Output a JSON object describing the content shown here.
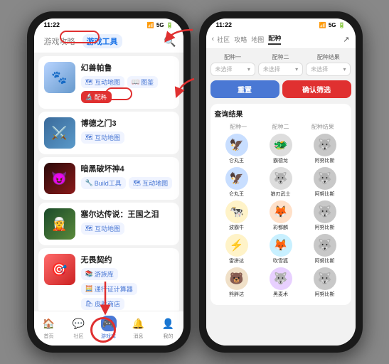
{
  "phone1": {
    "statusBar": {
      "time": "11:22",
      "icons": "📶 5G ◼"
    },
    "header": {
      "tab1": "游戏攻略",
      "tab2": "游戏工具",
      "searchIcon": "🔍"
    },
    "games": [
      {
        "id": "pokemon",
        "name": "幻兽帕鲁",
        "thumb": "🐾",
        "thumbClass": "thumb-pokemon",
        "tools": [
          {
            "label": "互动地图",
            "icon": "🗺",
            "class": "tool-btn"
          },
          {
            "label": "图鉴",
            "icon": "📖",
            "class": "tool-btn"
          },
          {
            "label": "配种",
            "icon": "🔬",
            "class": "tool-btn red-highlight"
          }
        ]
      },
      {
        "id": "botw",
        "name": "博德之门3",
        "thumb": "⚔️",
        "thumbClass": "thumb-botw",
        "tools": [
          {
            "label": "互动地图",
            "icon": "🗺",
            "class": "tool-btn"
          }
        ]
      },
      {
        "id": "diablo",
        "name": "暗黑破坏神4",
        "thumb": "😈",
        "thumbClass": "thumb-diablo",
        "tools": [
          {
            "label": "Build工具",
            "icon": "🔧",
            "class": "tool-btn"
          },
          {
            "label": "互动地图",
            "icon": "🗺",
            "class": "tool-btn"
          }
        ]
      },
      {
        "id": "zelda",
        "name": "塞尔达传说：王国之泪",
        "thumb": "🧝",
        "thumbClass": "thumb-zelda",
        "tools": [
          {
            "label": "互动地图",
            "icon": "🗺",
            "class": "tool-btn"
          }
        ]
      },
      {
        "id": "free",
        "name": "无畏契约",
        "thumb": "🎯",
        "thumbClass": "thumb-free",
        "tools": [
          {
            "label": "游族库",
            "icon": "📚",
            "class": "tool-btn"
          },
          {
            "label": "通行证计算器",
            "icon": "🧮",
            "class": "tool-btn"
          },
          {
            "label": "皮肤商店",
            "icon": "🛍",
            "class": "tool-btn"
          }
        ]
      }
    ],
    "bottomNav": [
      {
        "icon": "🏠",
        "label": "首页",
        "active": false
      },
      {
        "icon": "💬",
        "label": "社区",
        "active": false
      },
      {
        "icon": "🎮",
        "label": "游戏库",
        "active": true
      },
      {
        "icon": "🔔",
        "label": "消息",
        "active": false
      },
      {
        "icon": "👤",
        "label": "我的",
        "active": false
      }
    ]
  },
  "phone2": {
    "statusBar": {
      "time": "11:22",
      "icons": "📶 5G ◼"
    },
    "header": {
      "tabs": [
        "社区",
        "攻略",
        "地图",
        "配种"
      ],
      "activeTab": "配种",
      "shareIcon": "↗"
    },
    "breeding": {
      "selectors": [
        {
          "label": "配种一",
          "placeholder": "未选择"
        },
        {
          "label": "配种二",
          "placeholder": "未选择"
        },
        {
          "label": "配种结果",
          "placeholder": "未选择"
        }
      ],
      "resetBtn": "重置",
      "confirmBtn": "确认筛选",
      "resultsTitle": "查询结果",
      "resultsHeader": [
        "配种一",
        "配种二",
        "配种结果"
      ],
      "results": [
        {
          "p1": {
            "emoji": "🦅",
            "name": "仑丸王",
            "bg": "av-blue"
          },
          "p2": {
            "emoji": "🐲",
            "name": "霸德龙",
            "bg": "av-gray"
          },
          "r": {
            "emoji": "🐺",
            "name": "阿努比斯",
            "bg": "av-darkgray"
          }
        },
        {
          "p1": {
            "emoji": "🦅",
            "name": "仑丸王",
            "bg": "av-blue"
          },
          "p2": {
            "emoji": "🐺",
            "name": "狼刃武士",
            "bg": "av-gray"
          },
          "r": {
            "emoji": "🐺",
            "name": "阿努比斯",
            "bg": "av-darkgray"
          }
        },
        {
          "p1": {
            "emoji": "🐄",
            "name": "波霸牛",
            "bg": "av-yellow"
          },
          "p2": {
            "emoji": "🦊",
            "name": "彩都麟",
            "bg": "av-orange"
          },
          "r": {
            "emoji": "🐺",
            "name": "阿努比斯",
            "bg": "av-darkgray"
          }
        },
        {
          "p1": {
            "emoji": "⚡",
            "name": "雷拼达",
            "bg": "av-yellow"
          },
          "p2": {
            "emoji": "🦊",
            "name": "吹雪狐",
            "bg": "av-teal"
          },
          "r": {
            "emoji": "🐺",
            "name": "阿努比斯",
            "bg": "av-darkgray"
          }
        },
        {
          "p1": {
            "emoji": "🐻",
            "name": "熊胖达",
            "bg": "av-brown"
          },
          "p2": {
            "emoji": "🐺",
            "name": "黑麦术",
            "bg": "av-purple"
          },
          "r": {
            "emoji": "🐺",
            "name": "阿努比斯",
            "bg": "av-darkgray"
          }
        }
      ]
    }
  },
  "arrows": {
    "tab_highlight": "游戏工具 tab is highlighted",
    "breed_circled": "配种 tool button is circled",
    "nav_circled": "游戏库 bottom nav is circled"
  }
}
